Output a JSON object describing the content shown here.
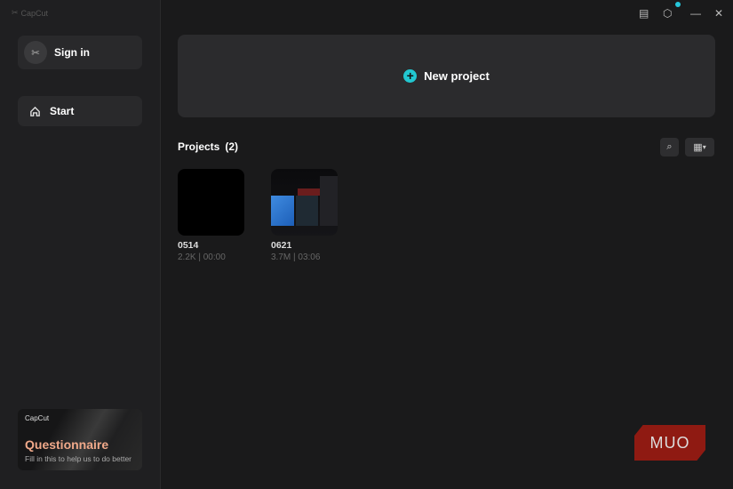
{
  "app": {
    "logo": "CapCut"
  },
  "sidebar": {
    "sign_in": "Sign in",
    "start": "Start",
    "questionnaire": {
      "logo": "CapCut",
      "title": "Questionnaire",
      "subtitle": "Fill in this to help us to do better"
    }
  },
  "main": {
    "new_project": "New project",
    "projects_label": "Projects",
    "projects_count": "(2)",
    "projects": [
      {
        "name": "0514",
        "meta": "2.2K | 00:00"
      },
      {
        "name": "0621",
        "meta": "3.7M | 03:06"
      }
    ]
  },
  "watermark": "MUO",
  "colors": {
    "accent": "#22c7d0",
    "questionnaire_title": "#f0a98a"
  }
}
